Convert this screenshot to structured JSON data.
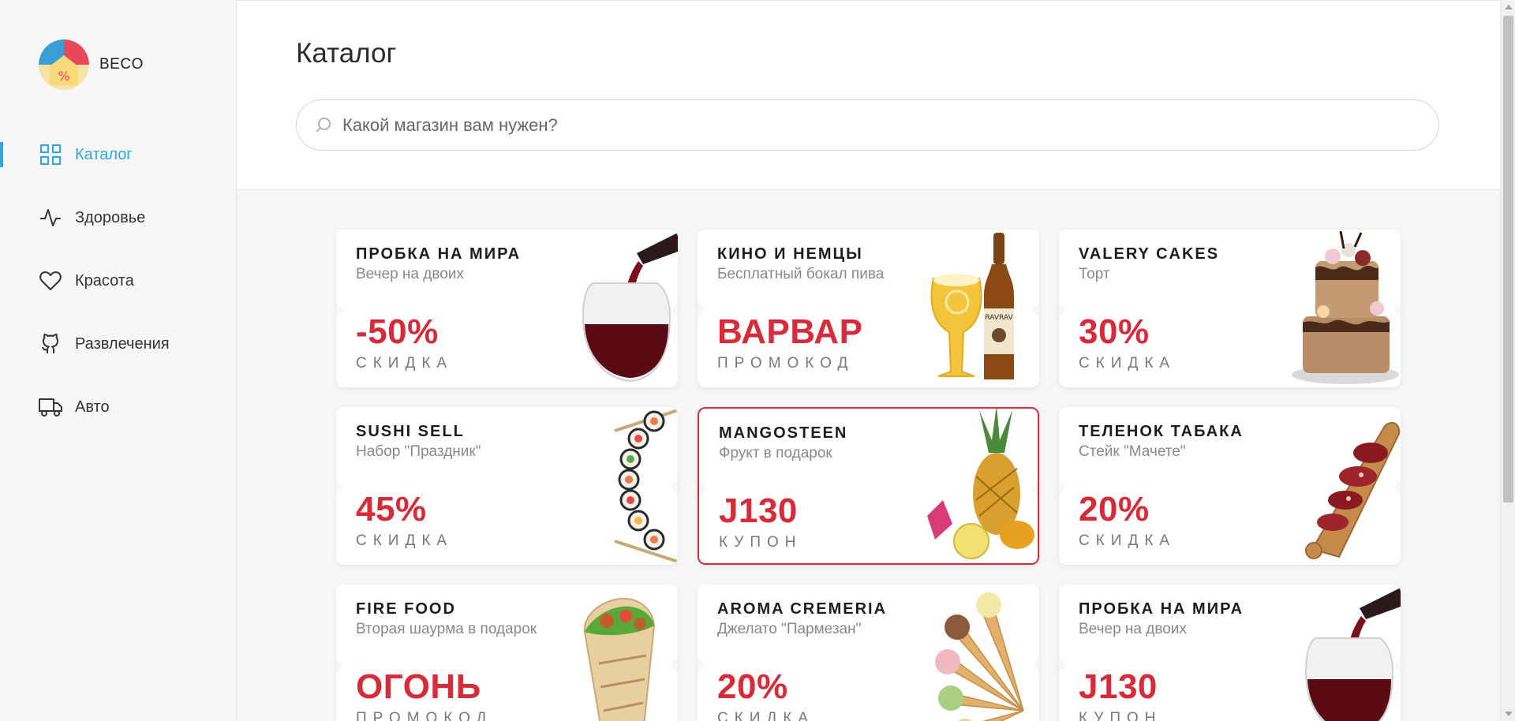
{
  "brand": {
    "name": "BECO"
  },
  "sidebar": {
    "items": [
      {
        "label": "Каталог",
        "icon": "grid-icon"
      },
      {
        "label": "Здоровье",
        "icon": "pulse-icon"
      },
      {
        "label": "Красота",
        "icon": "heart-icon"
      },
      {
        "label": "Развлечения",
        "icon": "github-icon"
      },
      {
        "label": "Авто",
        "icon": "truck-icon"
      }
    ]
  },
  "header": {
    "title": "Каталог",
    "search_placeholder": "Какой магазин вам нужен?"
  },
  "cards": [
    {
      "title": "ПРОБКА НА МИРА",
      "subtitle": "Вечер на двоих",
      "value": "-50%",
      "label": "СКИДКА",
      "image": "wine-glass"
    },
    {
      "title": "КИНО И НЕМЦЫ",
      "subtitle": "Бесплатный бокал пива",
      "value": "ВАРВАР",
      "label": "ПРОМОКОД",
      "image": "beer"
    },
    {
      "title": "VALERY CAKES",
      "subtitle": "Торт",
      "value": "30%",
      "label": "СКИДКА",
      "image": "cake"
    },
    {
      "title": "SUSHI SELL",
      "subtitle": "Набор \"Праздник\"",
      "value": "45%",
      "label": "СКИДКА",
      "image": "sushi"
    },
    {
      "title": "MANGOSTEEN",
      "subtitle": "Фрукт в подарок",
      "value": "J130",
      "label": "КУПОН",
      "image": "fruit"
    },
    {
      "title": "ТЕЛЕНОК ТАБАКА",
      "subtitle": "Стейк \"Мачете\"",
      "value": "20%",
      "label": "СКИДКА",
      "image": "steak"
    },
    {
      "title": "FIRE FOOD",
      "subtitle": "Вторая шаурма в подарок",
      "value": "ОГОНЬ",
      "label": "ПРОМОКОД",
      "image": "shawarma"
    },
    {
      "title": "AROMA CREMERIA",
      "subtitle": "Джелато \"Пармезан\"",
      "value": "20%",
      "label": "СКИДКА",
      "image": "ice-cream"
    },
    {
      "title": "ПРОБКА НА МИРА",
      "subtitle": "Вечер на двоих",
      "value": "J130",
      "label": "КУПОН",
      "image": "wine-glass"
    }
  ],
  "colors": {
    "accent": "#2aa8e0",
    "promo": "#d82b3a",
    "selected_border": "#d62c3a"
  }
}
